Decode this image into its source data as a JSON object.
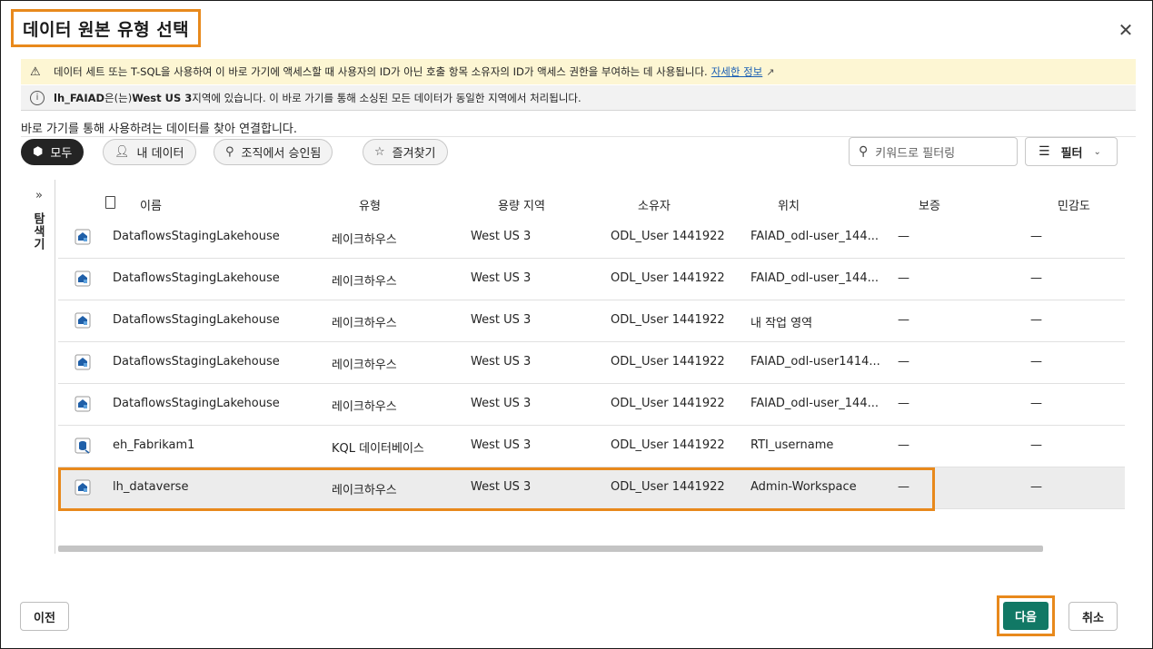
{
  "dialog": {
    "title": "데이터 원본 유형 선택",
    "close_icon": "close-icon"
  },
  "warning": {
    "text": "데이터 세트 또는 T-SQL을 사용하여 이 바로 가기에 액세스할 때 사용자의 ID가 아닌 호출 항목 소유자의 ID가 액세스 권한을 부여하는 데 사용됩니다.",
    "link": "자세한 정보"
  },
  "info": {
    "bold": "lh_FAIAD",
    "part1": "은(는) ",
    "region": "West US 3",
    "part2": " 지역에 있습니다. 이 바로 가기를 통해 소싱된 모든 데이터가 동일한 지역에서 처리됩니다."
  },
  "subtitle": "바로 가기를 통해 사용하려는 데이터를 찾아 연결합니다.",
  "filters": {
    "pills": [
      "모두",
      "내 데이터",
      "조직에서 승인됨",
      "즐겨찾기"
    ],
    "active": "모두",
    "search_placeholder": "키워드로 필터링",
    "filter_label": "필터"
  },
  "explorer": {
    "label": "탐색기"
  },
  "table": {
    "headers": [
      "이름",
      "유형",
      "용량 지역",
      "소유자",
      "위치",
      "보증",
      "민감도"
    ],
    "rows": [
      {
        "name": "DataflowsStagingLakehouse",
        "type": "레이크하우스",
        "region": "West US 3",
        "owner": "ODL_User 1441922",
        "location": "FAIAD_odl-user_144...",
        "endorsement": "—",
        "sensitivity": "—",
        "icon": "lakehouse-icon"
      },
      {
        "name": "DataflowsStagingLakehouse",
        "type": "레이크하우스",
        "region": "West US 3",
        "owner": "ODL_User 1441922",
        "location": "FAIAD_odl-user_144...",
        "endorsement": "—",
        "sensitivity": "—",
        "icon": "lakehouse-icon"
      },
      {
        "name": "DataflowsStagingLakehouse",
        "type": "레이크하우스",
        "region": "West US 3",
        "owner": "ODL_User 1441922",
        "location": "내 작업 영역",
        "endorsement": "—",
        "sensitivity": "—",
        "icon": "lakehouse-icon"
      },
      {
        "name": "DataflowsStagingLakehouse",
        "type": "레이크하우스",
        "region": "West US 3",
        "owner": "ODL_User 1441922",
        "location": "FAIAD_odl-user1414...",
        "endorsement": "—",
        "sensitivity": "—",
        "icon": "lakehouse-icon"
      },
      {
        "name": "DataflowsStagingLakehouse",
        "type": "레이크하우스",
        "region": "West US 3",
        "owner": "ODL_User 1441922",
        "location": "FAIAD_odl-user_144...",
        "endorsement": "—",
        "sensitivity": "—",
        "icon": "lakehouse-icon"
      },
      {
        "name": "eh_Fabrikam1",
        "type": "KQL 데이터베이스",
        "region": "West US 3",
        "owner": "ODL_User 1441922",
        "location": "RTI_username",
        "endorsement": "—",
        "sensitivity": "—",
        "icon": "kql-database-icon"
      },
      {
        "name": "lh_dataverse",
        "type": "레이크하우스",
        "region": "West US 3",
        "owner": "ODL_User 1441922",
        "location": "Admin-Workspace",
        "endorsement": "—",
        "sensitivity": "—",
        "icon": "lakehouse-icon",
        "selected": true
      }
    ]
  },
  "footer": {
    "prev_label": "이전",
    "next_label": "다음",
    "cancel_label": "취소"
  },
  "colors": {
    "accent_highlight": "#e8891c",
    "primary_button": "#117865",
    "warning_bg": "#fdf6d3"
  }
}
